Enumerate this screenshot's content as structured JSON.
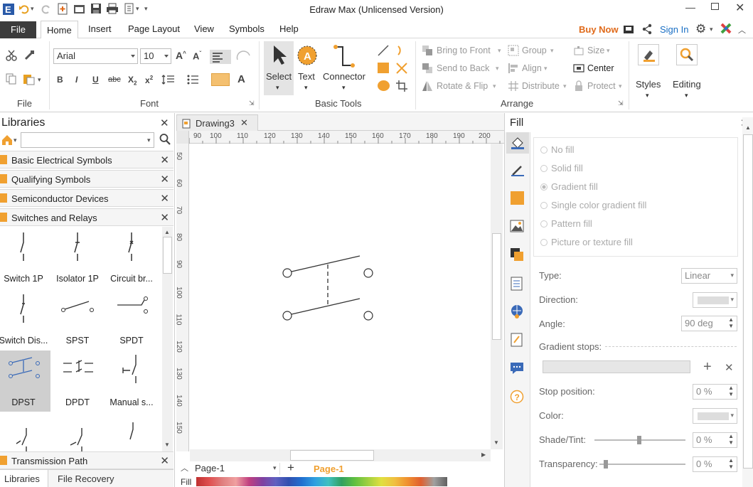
{
  "window": {
    "title": "Edraw Max (Unlicensed Version)"
  },
  "quick_access": {
    "icons": [
      "app-logo-icon",
      "undo-icon",
      "redo-icon",
      "new-icon",
      "open-icon",
      "save-icon",
      "print-icon",
      "export-icon"
    ]
  },
  "menu": {
    "file": "File",
    "tabs": [
      "Home",
      "Insert",
      "Page Layout",
      "View",
      "Symbols",
      "Help"
    ],
    "buy_now": "Buy Now",
    "sign_in": "Sign In"
  },
  "ribbon": {
    "file_group": {
      "label": "File"
    },
    "font": {
      "family": "Arial",
      "size": "10",
      "label": "Font"
    },
    "basic_tools": {
      "select": "Select",
      "text": "Text",
      "connector": "Connector",
      "label": "Basic Tools"
    },
    "arrange": {
      "bring_to_front": "Bring to Front",
      "send_to_back": "Send to Back",
      "rotate_flip": "Rotate & Flip",
      "group": "Group",
      "align": "Align",
      "distribute": "Distribute",
      "size": "Size",
      "center": "Center",
      "protect": "Protect",
      "label": "Arrange"
    },
    "styles": "Styles",
    "editing": "Editing"
  },
  "libraries": {
    "title": "Libraries",
    "search_value": "",
    "categories": [
      "Basic Electrical Symbols",
      "Qualifying Symbols",
      "Semiconductor Devices",
      "Switches and Relays"
    ],
    "symbols": [
      {
        "label": "Switch 1P"
      },
      {
        "label": "Isolator 1P"
      },
      {
        "label": "Circuit br..."
      },
      {
        "label": "Switch Dis..."
      },
      {
        "label": "SPST"
      },
      {
        "label": "SPDT"
      },
      {
        "label": "DPST"
      },
      {
        "label": "DPDT"
      },
      {
        "label": "Manual s..."
      }
    ],
    "bottom_category": "Transmission Path",
    "bottom_tabs": [
      "Libraries",
      "File Recovery"
    ]
  },
  "canvas": {
    "doc_tab": "Drawing3",
    "ruler_h": [
      "90",
      "100",
      "110",
      "120",
      "130",
      "140",
      "150",
      "160",
      "170",
      "180",
      "190",
      "200"
    ],
    "ruler_v": [
      "50",
      "60",
      "70",
      "80",
      "90",
      "100",
      "110",
      "120",
      "130",
      "140",
      "150"
    ],
    "page_select": "Page-1",
    "page_tab": "Page-1",
    "fill_label": "Fill"
  },
  "fill_panel": {
    "title": "Fill",
    "options": [
      "No fill",
      "Solid fill",
      "Gradient fill",
      "Single color gradient fill",
      "Pattern fill",
      "Picture or texture fill"
    ],
    "selected_option": "Gradient fill",
    "type_label": "Type:",
    "type_value": "Linear",
    "direction_label": "Direction:",
    "angle_label": "Angle:",
    "angle_value": "90 deg",
    "gradient_stops_label": "Gradient stops:",
    "stop_position_label": "Stop position:",
    "stop_position_value": "0 %",
    "color_label": "Color:",
    "shade_label": "Shade/Tint:",
    "shade_value": "0 %",
    "transparency_label": "Transparency:",
    "transparency_value": "0 %"
  },
  "colors": {
    "accent": "#f0a030",
    "file_bg": "#3c3c3c",
    "link": "#1a6fc4",
    "buy": "#e06a1a",
    "selected_symbol": "#cfcfcf"
  }
}
